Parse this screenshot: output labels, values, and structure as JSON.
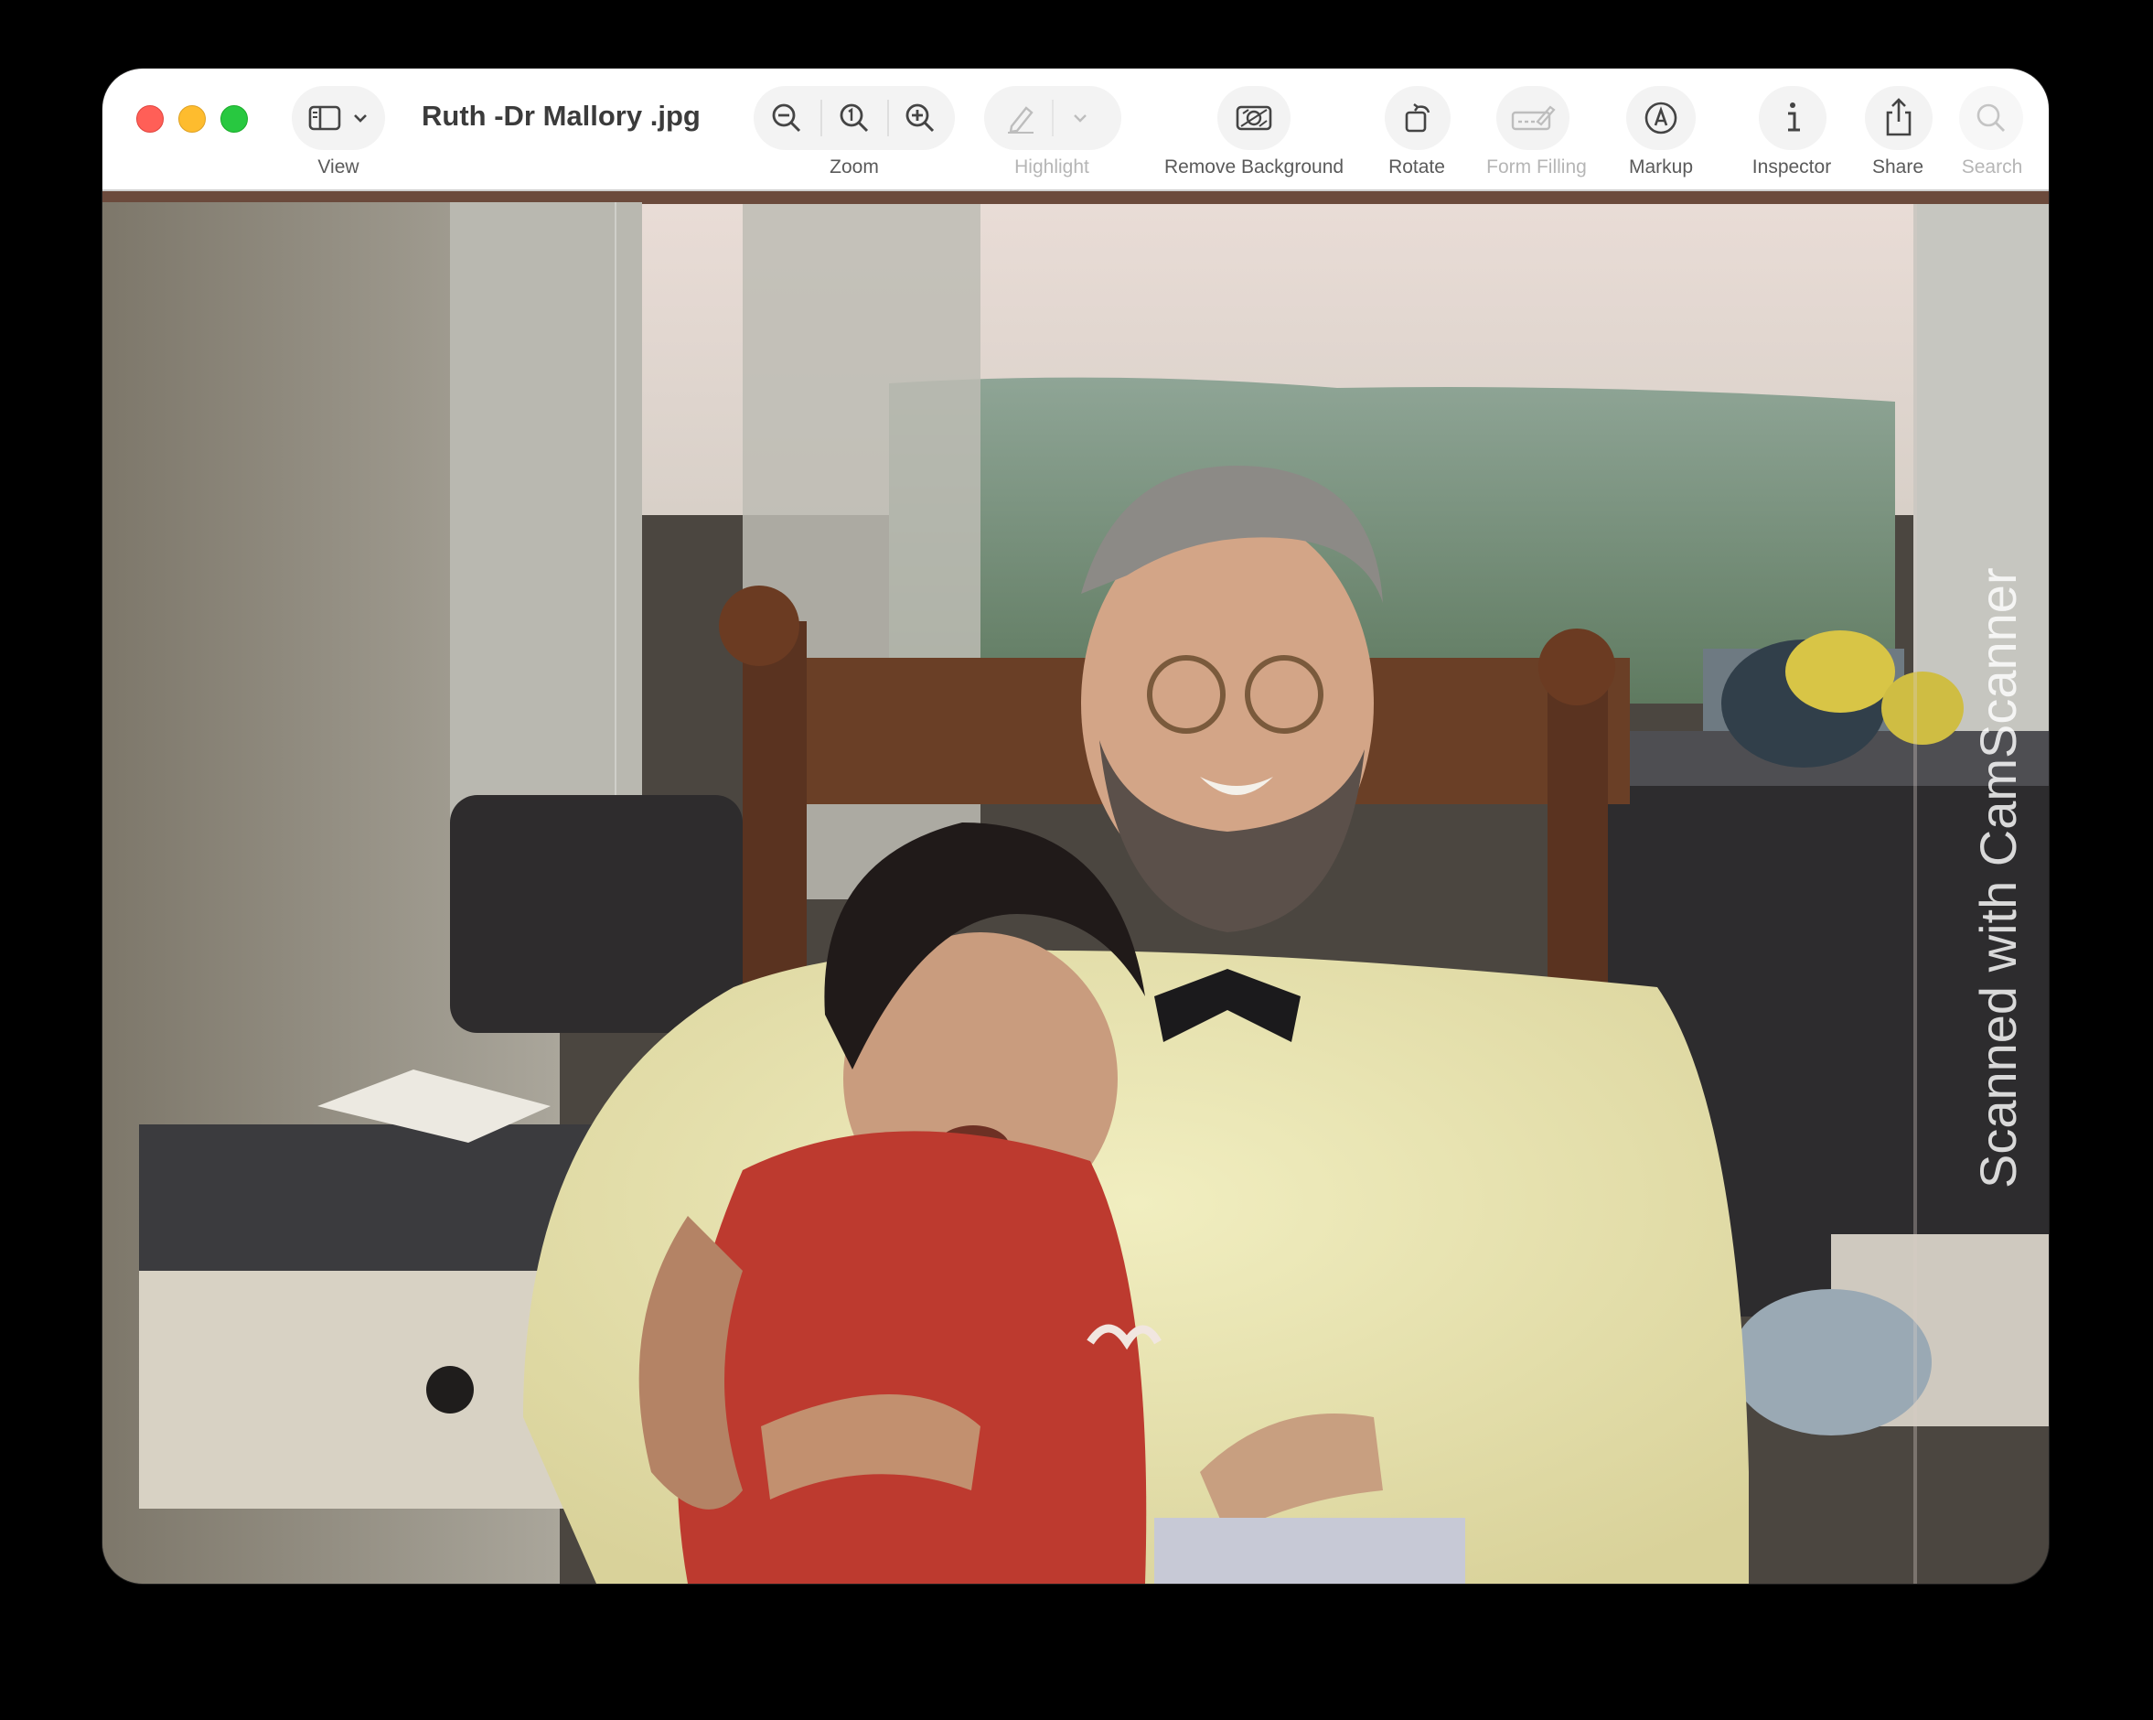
{
  "window": {
    "title": "Ruth -Dr Mallory .jpg"
  },
  "toolbar": {
    "view_label": "View",
    "zoom_label": "Zoom",
    "highlight_label": "Highlight",
    "remove_background_label": "Remove Background",
    "rotate_label": "Rotate",
    "form_filling_label": "Form Filling",
    "markup_label": "Markup",
    "inspector_label": "Inspector",
    "share_label": "Share",
    "search_label": "Search"
  },
  "photo": {
    "watermark_text": "Scanned with CamScanner",
    "watermark_logo": "CS"
  },
  "colors": {
    "close": "#ff5f57",
    "minimize": "#febc2e",
    "maximize": "#28c840"
  },
  "icons": [
    "sidebar-icon",
    "chevron-down-icon",
    "zoom-out-icon",
    "actual-size-icon",
    "zoom-in-icon",
    "highlight-pen-icon",
    "remove-background-icon",
    "rotate-icon",
    "form-filling-icon",
    "markup-icon",
    "info-icon",
    "share-icon",
    "search-icon"
  ]
}
